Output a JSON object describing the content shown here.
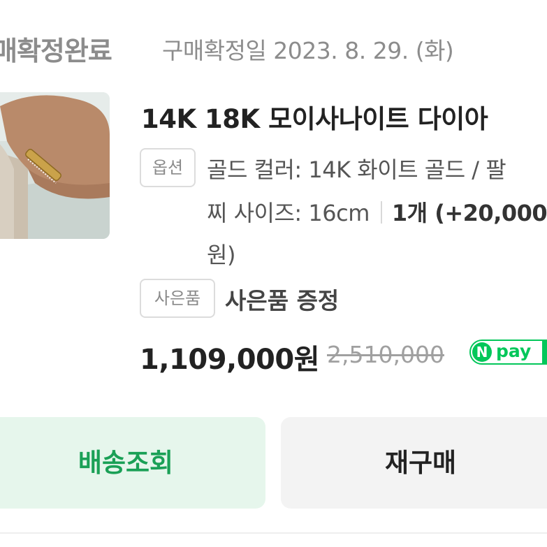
{
  "order": {
    "status_title": "매확정완료",
    "status_date": "구매확정일 2023. 8. 29. (화)"
  },
  "product": {
    "name": "14K 18K 모이사나이트 다이아",
    "option_tag": "옵션",
    "option_line_1": "골드 컬러: 14K 화이트 골드 / 팔",
    "option_line_2": "찌 사이즈: 16cm",
    "quantity": "1개 (+20,000",
    "option_line_3": "원)",
    "gift_tag": "사은품",
    "gift_text": "사은품 증정",
    "price": "1,109,000원",
    "original_price": "2,510,000",
    "npay_n": "N",
    "npay_label": "pay"
  },
  "actions": {
    "track_label": "배송조회",
    "rebuy_label": "재구매"
  },
  "colors": {
    "accent_green": "#03c75a",
    "track_bg": "#e6f6ec",
    "track_text": "#1aa056",
    "muted_gray": "#8c8c8c"
  }
}
